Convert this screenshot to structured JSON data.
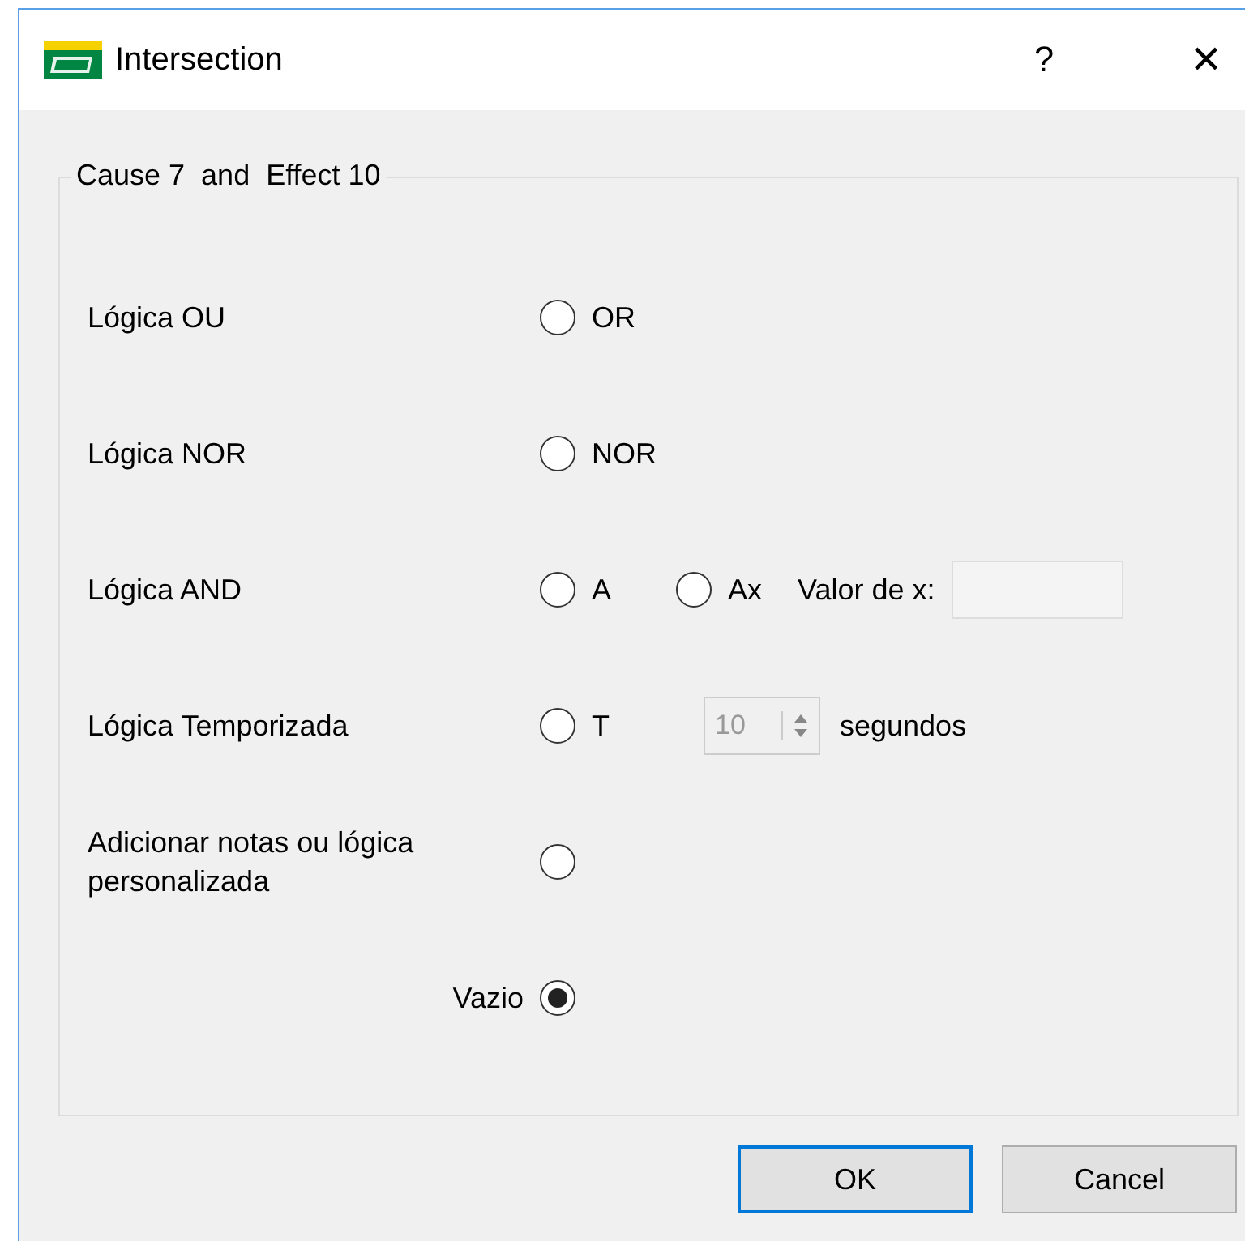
{
  "window": {
    "title": "Intersection",
    "help": "?",
    "close": "✕"
  },
  "group": {
    "title": "Cause 7  and  Effect 10"
  },
  "rows": [
    {
      "kind": "standard",
      "label": "Lógica OU",
      "options": [
        {
          "label": "OR",
          "selected": false
        }
      ]
    },
    {
      "kind": "standard",
      "label": "Lógica NOR",
      "options": [
        {
          "label": "NOR",
          "selected": false
        }
      ]
    },
    {
      "kind": "standard",
      "label": "Lógica AND",
      "options": [
        {
          "label": "A",
          "selected": false
        },
        {
          "label": "Ax",
          "selected": false
        }
      ],
      "extras": [
        {
          "kind": "field",
          "label": "Valor de x:"
        }
      ]
    },
    {
      "kind": "standard",
      "label": "Lógica Temporizada",
      "options": [
        {
          "label": "T",
          "selected": false
        }
      ],
      "extras": [
        {
          "kind": "spinbox",
          "value": "10",
          "disabled": true,
          "unit": "segundos"
        }
      ]
    },
    {
      "kind": "standard",
      "label": "Adicionar notas ou lógica personalizada",
      "options": [
        {
          "selected": false
        }
      ]
    },
    {
      "kind": "trailing",
      "label": "Vazio",
      "options": [
        {
          "selected": true
        }
      ]
    }
  ],
  "buttons": [
    {
      "label": "OK",
      "default": true
    },
    {
      "label": "Cancel",
      "default": false
    }
  ]
}
